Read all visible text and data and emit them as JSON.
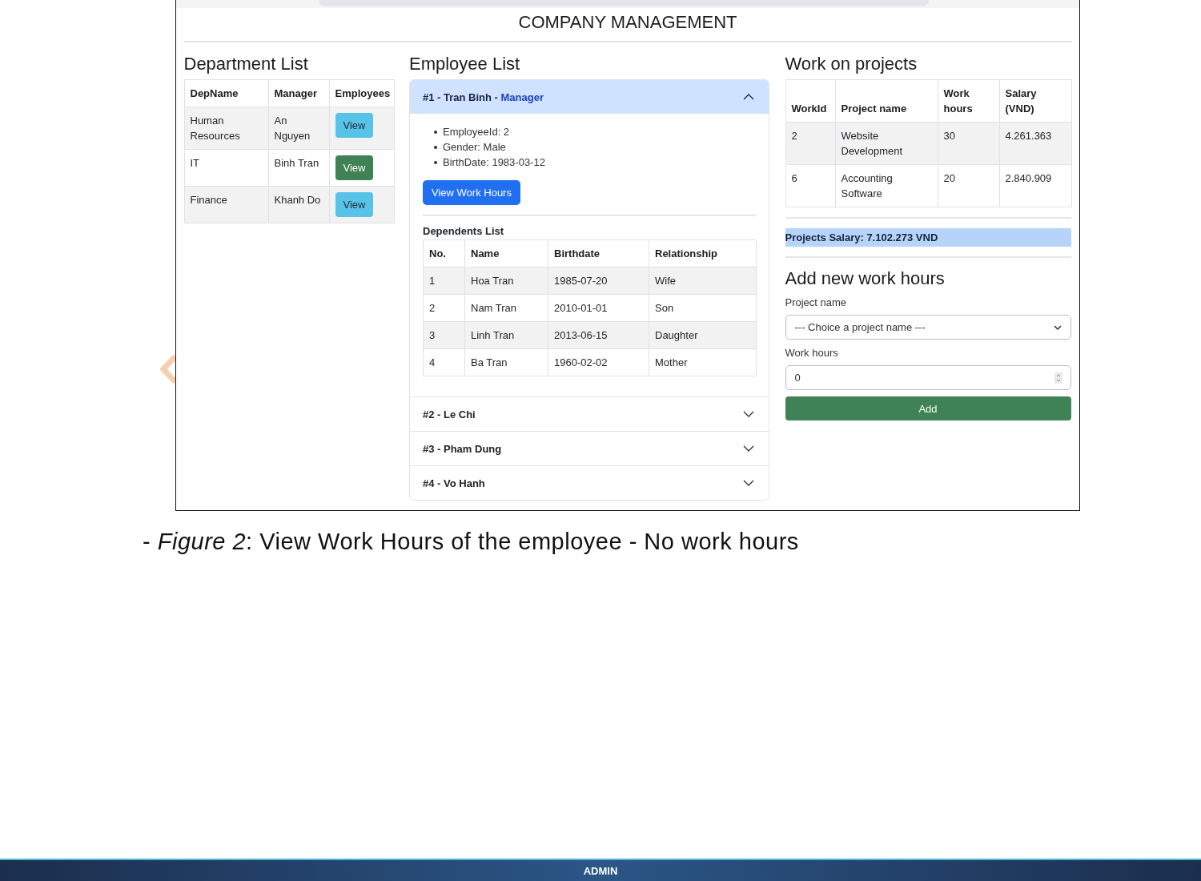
{
  "page": {
    "title": "COMPANY MANAGEMENT"
  },
  "departments": {
    "heading": "Department List",
    "columns": [
      "DepName",
      "Manager",
      "Employees"
    ],
    "rows": [
      {
        "name": "Human Resources",
        "manager": "An Nguyen",
        "action": "View",
        "selected": false
      },
      {
        "name": "IT",
        "manager": "Binh Tran",
        "action": "View",
        "selected": true
      },
      {
        "name": "Finance",
        "manager": "Khanh Do",
        "action": "View",
        "selected": false
      }
    ]
  },
  "employees": {
    "heading": "Employee List",
    "items": [
      {
        "title": "#1 - Tran Binh -",
        "role": "Manager",
        "expanded": true,
        "details": [
          "EmployeeId: 2",
          "Gender: Male",
          "BirthDate: 1983-03-12"
        ],
        "action": "View Work Hours",
        "dependents": {
          "heading": "Dependents List",
          "columns": [
            "No.",
            "Name",
            "Birthdate",
            "Relationship"
          ],
          "rows": [
            [
              "1",
              "Hoa Tran",
              "1985-07-20",
              "Wife"
            ],
            [
              "2",
              "Nam Tran",
              "2010-01-01",
              "Son"
            ],
            [
              "3",
              "Linh Tran",
              "2013-06-15",
              "Daughter"
            ],
            [
              "4",
              "Ba Tran",
              "1960-02-02",
              "Mother"
            ]
          ]
        }
      },
      {
        "title": "#2 - Le Chi",
        "expanded": false
      },
      {
        "title": "#3 - Pham Dung",
        "expanded": false
      },
      {
        "title": "#4 - Vo Hanh",
        "expanded": false
      }
    ]
  },
  "projects": {
    "heading": "Work on projects",
    "columns": [
      "WorkId",
      "Project name",
      "Work hours",
      "Salary (VND)"
    ],
    "rows": [
      [
        "2",
        "Website Development",
        "30",
        "4.261.363"
      ],
      [
        "6",
        "Accounting Software",
        "20",
        "2.840.909"
      ]
    ],
    "total": "Projects Salary: 7.102.273 VND"
  },
  "add_form": {
    "heading": "Add new work hours",
    "fields": [
      {
        "kind": "select",
        "label": "Project name",
        "value": "--- Choice a project name ---"
      },
      {
        "kind": "number",
        "label": "Work hours",
        "value": "0"
      }
    ],
    "submit": "Add"
  },
  "caption": "- *Figure 2*: View Work Hours of the employee - No work hours",
  "footer": {
    "label": "ADMIN"
  }
}
